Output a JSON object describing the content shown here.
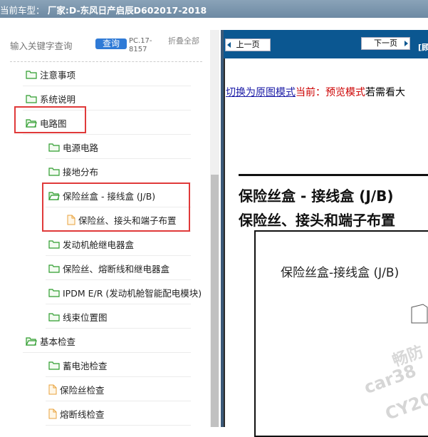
{
  "title_bar": {
    "prefix": "当前车型：",
    "maker_label": "厂家:",
    "vehicle": "D-东风日产启辰D602017-2018"
  },
  "search": {
    "placeholder": "输入关键字查询",
    "button_label": "查询",
    "code": "PC.17-8157",
    "collapse_all": "折叠全部"
  },
  "tree": [
    {
      "label": "注意事项",
      "type": "folder"
    },
    {
      "label": "系统说明",
      "type": "folder"
    },
    {
      "label": "电路图",
      "type": "folder-open"
    },
    {
      "label": "电源电路",
      "type": "folder"
    },
    {
      "label": "接地分布",
      "type": "folder"
    },
    {
      "label": "保险丝盒 - 接线盒 (J/B)",
      "type": "folder-open"
    },
    {
      "label": "保险丝、接头和端子布置",
      "type": "doc"
    },
    {
      "label": "发动机舱继电器盒",
      "type": "folder"
    },
    {
      "label": "保险丝、熔断线和继电器盒",
      "type": "folder"
    },
    {
      "label": "IPDM E/R (发动机舱智能配电模块)",
      "type": "folder"
    },
    {
      "label": "线束位置图",
      "type": "folder"
    },
    {
      "label": "基本检查",
      "type": "folder-open"
    },
    {
      "label": "蓄电池检查",
      "type": "folder"
    },
    {
      "label": "保险丝检查",
      "type": "doc"
    },
    {
      "label": "熔断线检查",
      "type": "doc"
    }
  ],
  "viewer": {
    "prev_label": "上一页",
    "next_label": "下一页",
    "corner_label": "[顾",
    "switch_link": "切换为原图模式",
    "current_label": "当前：",
    "mode_label": "预览模式",
    "tail_text": "若需看大",
    "doc_title_line1": "保险丝盒 - 接线盒 (J/B)",
    "doc_title_line2": "保险丝、接头和端子布置",
    "diagram_caption": "保险丝盒-接线盒 (J/B)",
    "watermark_line1": "畅防",
    "watermark_line2": "car38",
    "watermark_line3": "CY20"
  },
  "colors": {
    "folder": "#2e9c2e",
    "doc": "#e8a23c",
    "highlight": "#e03a3a",
    "toolbar": "#0b5791",
    "button": "#2f7ad6"
  }
}
